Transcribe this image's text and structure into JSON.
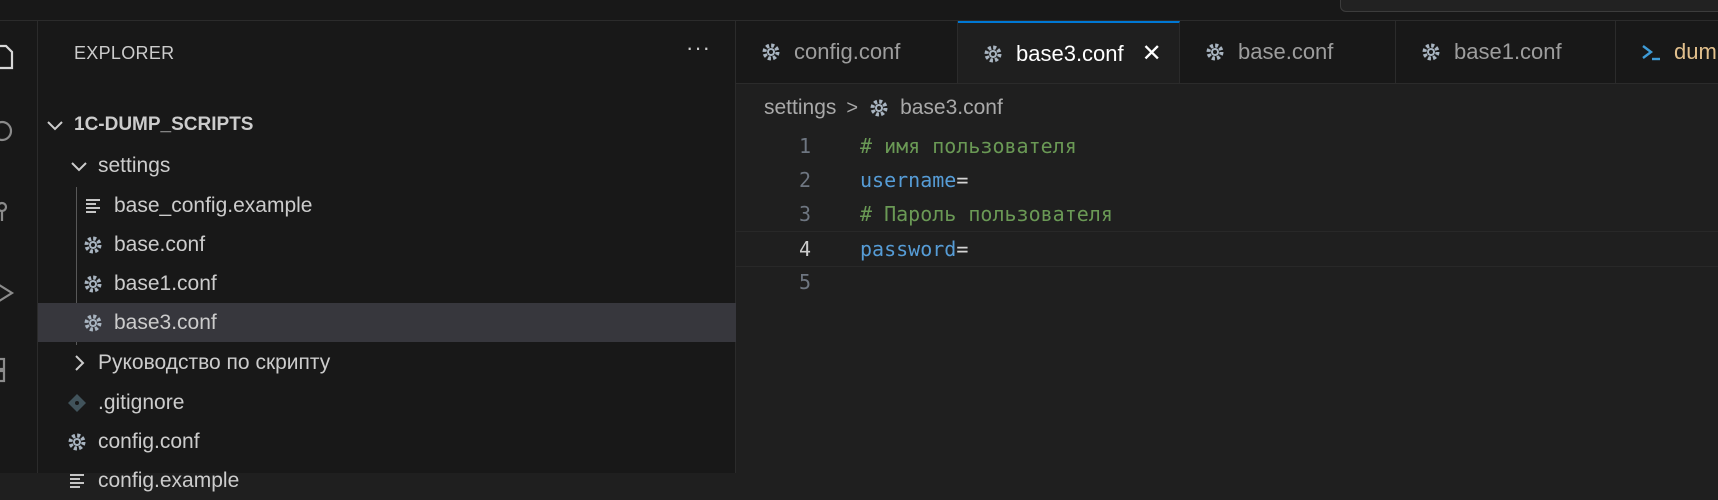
{
  "sidebar": {
    "title": "EXPLORER",
    "more": "···",
    "root": "1C-DUMP_SCRIPTS",
    "items": [
      {
        "label": "settings"
      },
      {
        "label": "base_config.example"
      },
      {
        "label": "base.conf"
      },
      {
        "label": "base1.conf"
      },
      {
        "label": "base3.conf"
      },
      {
        "label": "Руководство по скрипту"
      },
      {
        "label": ".gitignore"
      },
      {
        "label": "config.conf"
      },
      {
        "label": "config.example"
      }
    ]
  },
  "tabs": [
    {
      "label": "config.conf",
      "icon": "gear-icon"
    },
    {
      "label": "base3.conf",
      "icon": "gear-icon",
      "active": true,
      "close": "✕"
    },
    {
      "label": "base.conf",
      "icon": "gear-icon"
    },
    {
      "label": "base1.conf",
      "icon": "gear-icon"
    },
    {
      "label": "dum",
      "icon": "powershell-icon"
    }
  ],
  "breadcrumb": {
    "folder": "settings",
    "separator": ">",
    "file": "base3.conf"
  },
  "editor": {
    "current_line": 4,
    "lines": [
      {
        "n": "1",
        "a": "# имя пользователя",
        "b": ""
      },
      {
        "n": "2",
        "a": "username",
        "b": "="
      },
      {
        "n": "3",
        "a": "# Пароль пользователя",
        "b": ""
      },
      {
        "n": "4",
        "a": "password",
        "b": "="
      },
      {
        "n": "5",
        "a": "",
        "b": ""
      }
    ]
  },
  "colors": {
    "accent": "#0078d4",
    "comment": "#6a9955",
    "keyword": "#569cd6",
    "selected_row": "#37373d"
  }
}
